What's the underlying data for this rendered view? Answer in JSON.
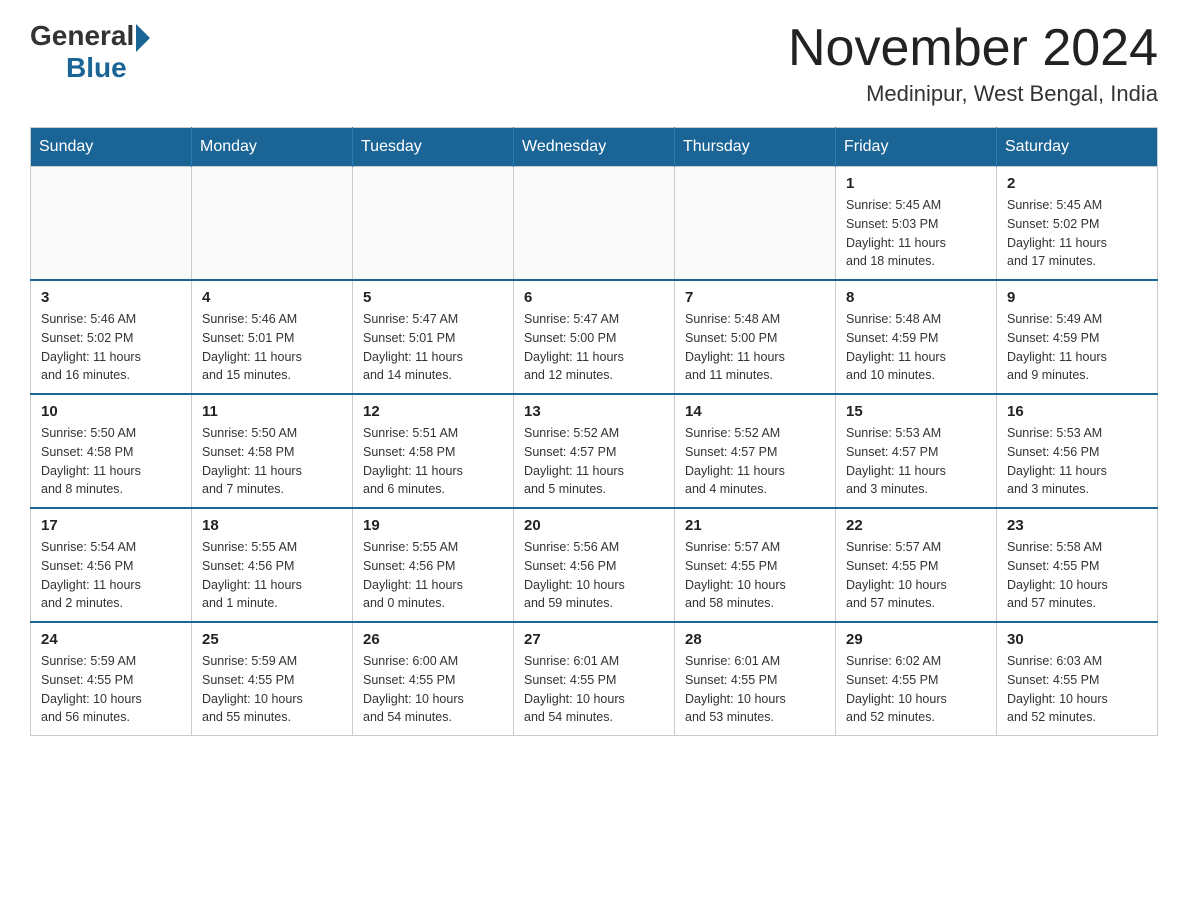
{
  "logo": {
    "general": "General",
    "blue": "Blue"
  },
  "title": "November 2024",
  "location": "Medinipur, West Bengal, India",
  "weekdays": [
    "Sunday",
    "Monday",
    "Tuesday",
    "Wednesday",
    "Thursday",
    "Friday",
    "Saturday"
  ],
  "weeks": [
    [
      {
        "day": "",
        "info": ""
      },
      {
        "day": "",
        "info": ""
      },
      {
        "day": "",
        "info": ""
      },
      {
        "day": "",
        "info": ""
      },
      {
        "day": "",
        "info": ""
      },
      {
        "day": "1",
        "info": "Sunrise: 5:45 AM\nSunset: 5:03 PM\nDaylight: 11 hours\nand 18 minutes."
      },
      {
        "day": "2",
        "info": "Sunrise: 5:45 AM\nSunset: 5:02 PM\nDaylight: 11 hours\nand 17 minutes."
      }
    ],
    [
      {
        "day": "3",
        "info": "Sunrise: 5:46 AM\nSunset: 5:02 PM\nDaylight: 11 hours\nand 16 minutes."
      },
      {
        "day": "4",
        "info": "Sunrise: 5:46 AM\nSunset: 5:01 PM\nDaylight: 11 hours\nand 15 minutes."
      },
      {
        "day": "5",
        "info": "Sunrise: 5:47 AM\nSunset: 5:01 PM\nDaylight: 11 hours\nand 14 minutes."
      },
      {
        "day": "6",
        "info": "Sunrise: 5:47 AM\nSunset: 5:00 PM\nDaylight: 11 hours\nand 12 minutes."
      },
      {
        "day": "7",
        "info": "Sunrise: 5:48 AM\nSunset: 5:00 PM\nDaylight: 11 hours\nand 11 minutes."
      },
      {
        "day": "8",
        "info": "Sunrise: 5:48 AM\nSunset: 4:59 PM\nDaylight: 11 hours\nand 10 minutes."
      },
      {
        "day": "9",
        "info": "Sunrise: 5:49 AM\nSunset: 4:59 PM\nDaylight: 11 hours\nand 9 minutes."
      }
    ],
    [
      {
        "day": "10",
        "info": "Sunrise: 5:50 AM\nSunset: 4:58 PM\nDaylight: 11 hours\nand 8 minutes."
      },
      {
        "day": "11",
        "info": "Sunrise: 5:50 AM\nSunset: 4:58 PM\nDaylight: 11 hours\nand 7 minutes."
      },
      {
        "day": "12",
        "info": "Sunrise: 5:51 AM\nSunset: 4:58 PM\nDaylight: 11 hours\nand 6 minutes."
      },
      {
        "day": "13",
        "info": "Sunrise: 5:52 AM\nSunset: 4:57 PM\nDaylight: 11 hours\nand 5 minutes."
      },
      {
        "day": "14",
        "info": "Sunrise: 5:52 AM\nSunset: 4:57 PM\nDaylight: 11 hours\nand 4 minutes."
      },
      {
        "day": "15",
        "info": "Sunrise: 5:53 AM\nSunset: 4:57 PM\nDaylight: 11 hours\nand 3 minutes."
      },
      {
        "day": "16",
        "info": "Sunrise: 5:53 AM\nSunset: 4:56 PM\nDaylight: 11 hours\nand 3 minutes."
      }
    ],
    [
      {
        "day": "17",
        "info": "Sunrise: 5:54 AM\nSunset: 4:56 PM\nDaylight: 11 hours\nand 2 minutes."
      },
      {
        "day": "18",
        "info": "Sunrise: 5:55 AM\nSunset: 4:56 PM\nDaylight: 11 hours\nand 1 minute."
      },
      {
        "day": "19",
        "info": "Sunrise: 5:55 AM\nSunset: 4:56 PM\nDaylight: 11 hours\nand 0 minutes."
      },
      {
        "day": "20",
        "info": "Sunrise: 5:56 AM\nSunset: 4:56 PM\nDaylight: 10 hours\nand 59 minutes."
      },
      {
        "day": "21",
        "info": "Sunrise: 5:57 AM\nSunset: 4:55 PM\nDaylight: 10 hours\nand 58 minutes."
      },
      {
        "day": "22",
        "info": "Sunrise: 5:57 AM\nSunset: 4:55 PM\nDaylight: 10 hours\nand 57 minutes."
      },
      {
        "day": "23",
        "info": "Sunrise: 5:58 AM\nSunset: 4:55 PM\nDaylight: 10 hours\nand 57 minutes."
      }
    ],
    [
      {
        "day": "24",
        "info": "Sunrise: 5:59 AM\nSunset: 4:55 PM\nDaylight: 10 hours\nand 56 minutes."
      },
      {
        "day": "25",
        "info": "Sunrise: 5:59 AM\nSunset: 4:55 PM\nDaylight: 10 hours\nand 55 minutes."
      },
      {
        "day": "26",
        "info": "Sunrise: 6:00 AM\nSunset: 4:55 PM\nDaylight: 10 hours\nand 54 minutes."
      },
      {
        "day": "27",
        "info": "Sunrise: 6:01 AM\nSunset: 4:55 PM\nDaylight: 10 hours\nand 54 minutes."
      },
      {
        "day": "28",
        "info": "Sunrise: 6:01 AM\nSunset: 4:55 PM\nDaylight: 10 hours\nand 53 minutes."
      },
      {
        "day": "29",
        "info": "Sunrise: 6:02 AM\nSunset: 4:55 PM\nDaylight: 10 hours\nand 52 minutes."
      },
      {
        "day": "30",
        "info": "Sunrise: 6:03 AM\nSunset: 4:55 PM\nDaylight: 10 hours\nand 52 minutes."
      }
    ]
  ]
}
